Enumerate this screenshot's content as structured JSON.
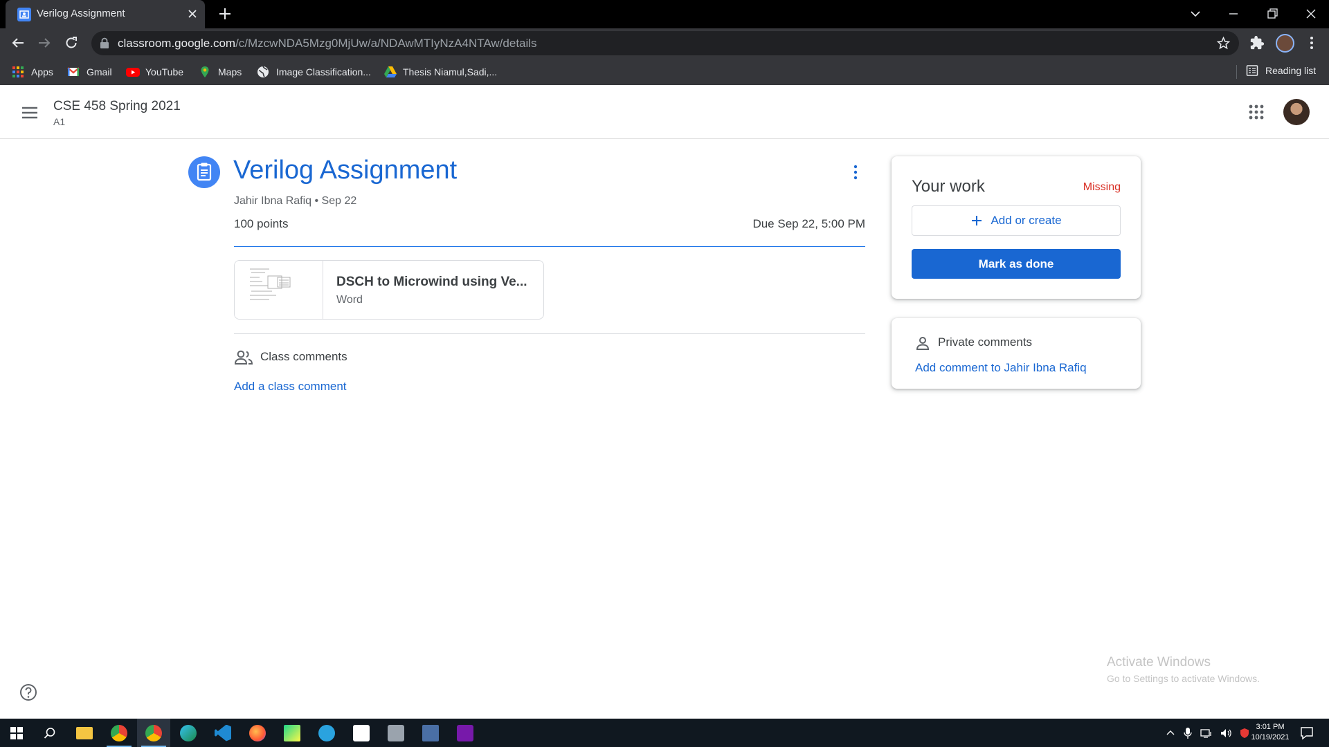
{
  "browser": {
    "tab_title": "Verilog Assignment",
    "url_host": "classroom.google.com",
    "url_path": "/c/MzcwNDA5Mzg0MjUw/a/NDAwMTIyNzA4NTAw/details",
    "bookmarks": [
      {
        "label": "Apps",
        "icon": "apps-grid-icon"
      },
      {
        "label": "Gmail",
        "icon": "gmail-icon"
      },
      {
        "label": "YouTube",
        "icon": "youtube-icon"
      },
      {
        "label": "Maps",
        "icon": "maps-icon"
      },
      {
        "label": "Image Classification...",
        "icon": "globe-icon"
      },
      {
        "label": "Thesis Niamul,Sadi,...",
        "icon": "drive-icon"
      }
    ],
    "reading_list": "Reading list"
  },
  "header": {
    "class_name": "CSE 458 Spring 2021",
    "section": "A1"
  },
  "assignment": {
    "title": "Verilog Assignment",
    "author_line": "Jahir Ibna Rafiq • Sep 22",
    "points": "100 points",
    "due": "Due Sep 22, 5:00 PM",
    "attachment": {
      "title": "DSCH to Microwind using Ve...",
      "type": "Word"
    },
    "class_comments_label": "Class comments",
    "add_class_comment": "Add a class comment"
  },
  "your_work": {
    "title": "Your work",
    "status": "Missing",
    "add_or_create": "Add or create",
    "mark_as_done": "Mark as done"
  },
  "private_comments": {
    "title": "Private comments",
    "add_comment": "Add comment to Jahir Ibna Rafiq"
  },
  "watermark": {
    "line1": "Activate Windows",
    "line2": "Go to Settings to activate Windows."
  },
  "taskbar": {
    "time": "3:01 PM",
    "date": "10/19/2021"
  },
  "colors": {
    "accent": "#1967d2",
    "missing": "#d93025",
    "chrome_dark": "#35363a"
  }
}
